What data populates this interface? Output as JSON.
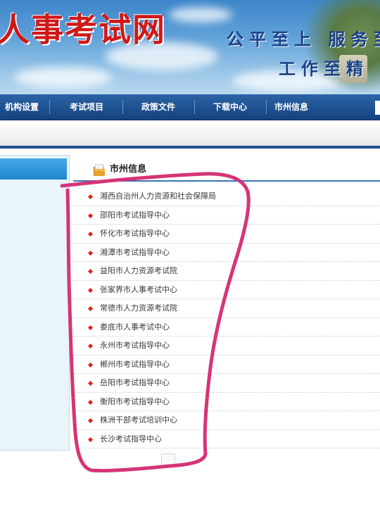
{
  "banner": {
    "logo_text": "人事考试网",
    "slogan_line1": "公平至上  服务至诚",
    "slogan_line2": "工作至精  管"
  },
  "nav": {
    "items": [
      {
        "label": "机构设置"
      },
      {
        "label": "考试项目"
      },
      {
        "label": "政策文件"
      },
      {
        "label": "下载中心"
      },
      {
        "label": "市州信息"
      }
    ]
  },
  "panel": {
    "title": "市州信息",
    "icon": "folder-icon",
    "items": [
      {
        "label": "湘西自治州人力资源和社会保障局"
      },
      {
        "label": "邵阳市考试指导中心"
      },
      {
        "label": "怀化市考试指导中心"
      },
      {
        "label": "湘潭市考试指导中心"
      },
      {
        "label": "益阳市人力资源考试院"
      },
      {
        "label": "张家界市人事考试中心"
      },
      {
        "label": "常德市人力资源考试院"
      },
      {
        "label": "娄底市人事考试中心"
      },
      {
        "label": "永州市考试指导中心"
      },
      {
        "label": "郴州市考试指导中心"
      },
      {
        "label": "岳阳市考试指导中心"
      },
      {
        "label": "衡阳市考试指导中心"
      },
      {
        "label": "株洲干部考试培训中心"
      },
      {
        "label": "长沙考试指导中心"
      }
    ]
  },
  "colors": {
    "nav_bg": "#14427f",
    "accent_red": "#e0201d",
    "markup_pink": "#d63477"
  }
}
